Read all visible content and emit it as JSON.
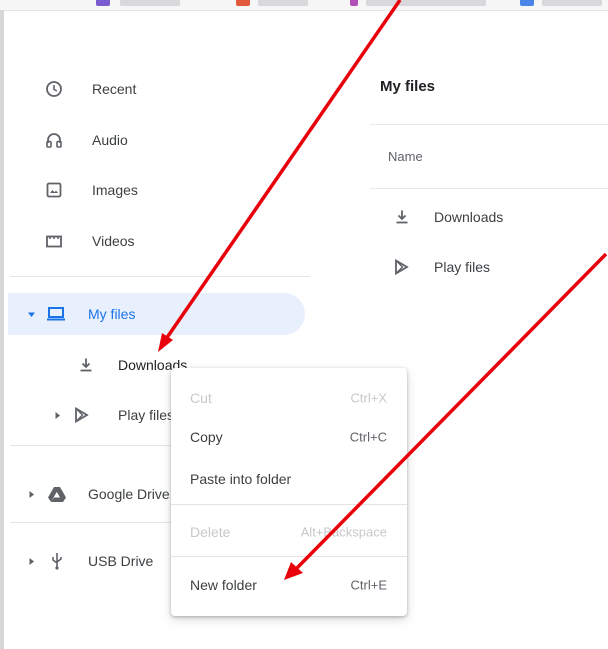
{
  "sidebar": {
    "items": [
      {
        "label": "Recent",
        "icon": "clock-icon"
      },
      {
        "label": "Audio",
        "icon": "headphones-icon"
      },
      {
        "label": "Images",
        "icon": "image-icon"
      },
      {
        "label": "Videos",
        "icon": "video-icon"
      }
    ],
    "my_files": {
      "label": "My files",
      "icon": "laptop-icon"
    },
    "downloads": {
      "label": "Downloads",
      "icon": "download-icon"
    },
    "play_files": {
      "label": "Play files",
      "icon": "play-store-icon"
    },
    "google_drive": {
      "label": "Google Drive",
      "icon": "google-drive-icon"
    },
    "usb_drive": {
      "label": "USB Drive",
      "icon": "usb-icon"
    }
  },
  "main": {
    "title": "My files",
    "column_name": "Name",
    "files": [
      {
        "label": "Downloads",
        "icon": "download-icon"
      },
      {
        "label": "Play files",
        "icon": "play-store-icon"
      }
    ]
  },
  "context_menu": {
    "items": [
      {
        "label": "Cut",
        "shortcut": "Ctrl+X",
        "enabled": false
      },
      {
        "label": "Copy",
        "shortcut": "Ctrl+C",
        "enabled": true
      },
      {
        "label": "Paste into folder",
        "shortcut": "",
        "enabled": true
      },
      {
        "label": "Delete",
        "shortcut": "Alt+Backspace",
        "enabled": false
      },
      {
        "label": "New folder",
        "shortcut": "Ctrl+E",
        "enabled": true
      }
    ]
  },
  "colors": {
    "accent": "#1a73e8",
    "selected_bg": "#e8f0fe",
    "arrow": "#e8000b"
  }
}
